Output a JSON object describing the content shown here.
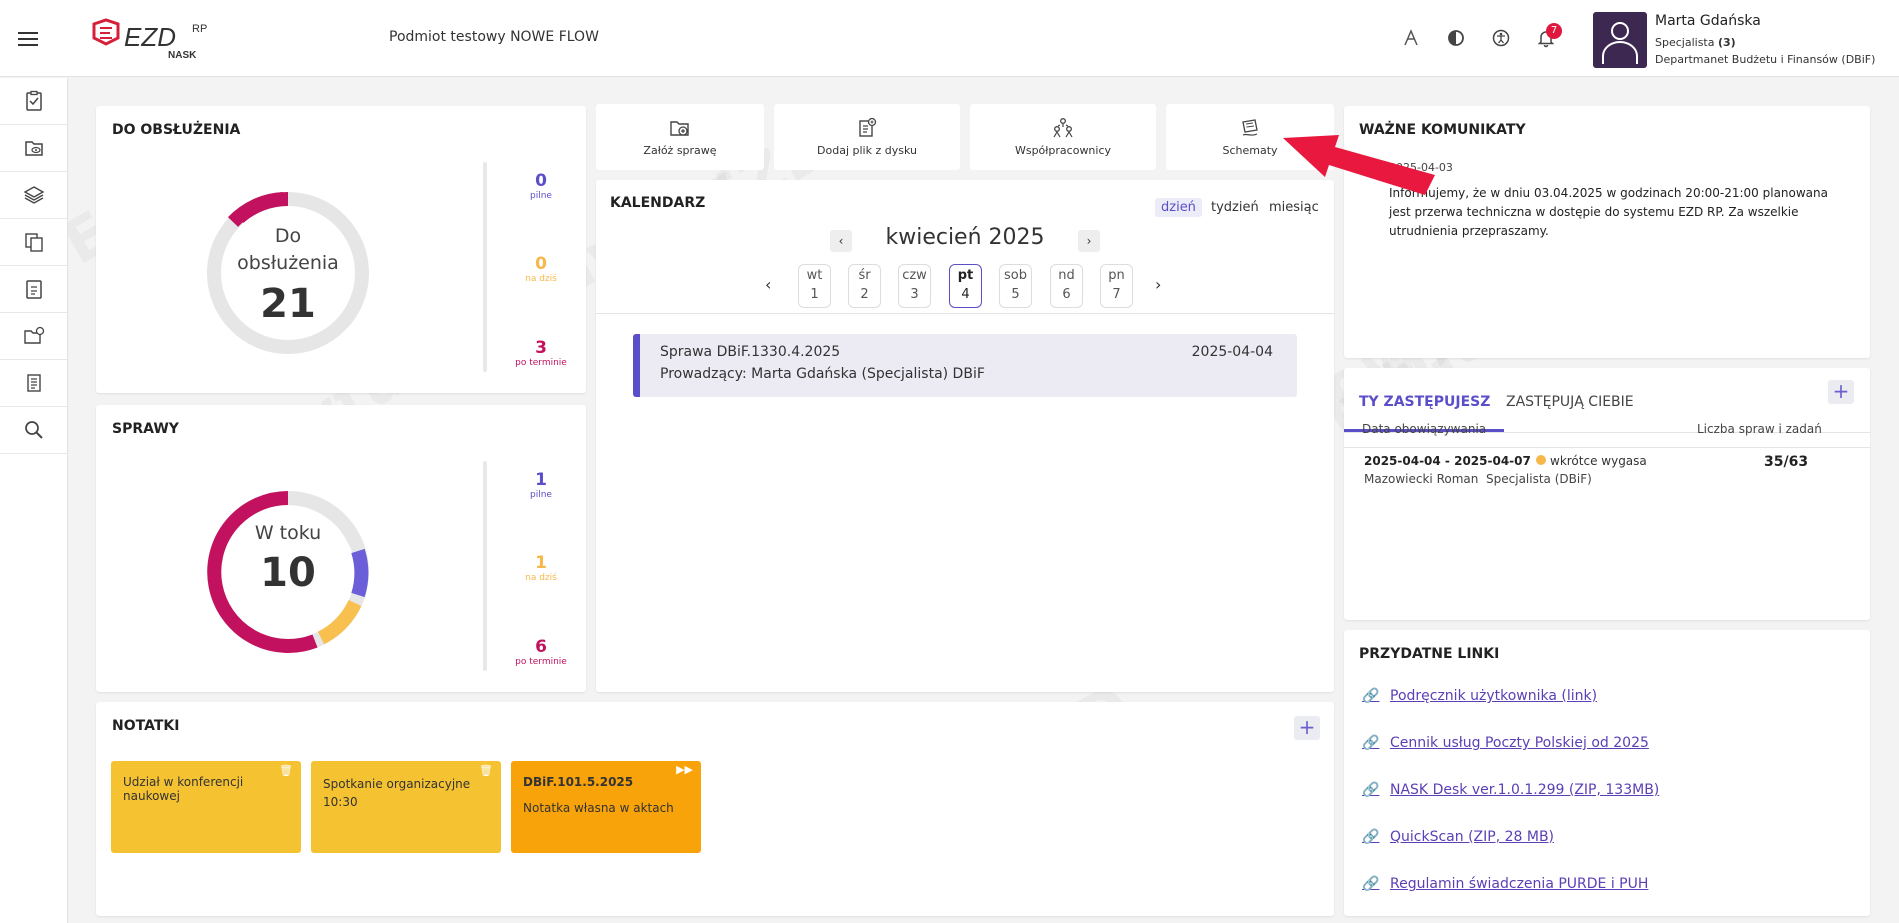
{
  "header": {
    "logo_text": "EZD",
    "logo_sup": "RP",
    "logo_sub": "NASK",
    "entity": "Podmiot testowy NOWE FLOW",
    "notifications_count": "7",
    "user": {
      "name": "Marta Gdańska",
      "role": "Specjalista",
      "role_count": "(3)",
      "department": "Departmanet Budżetu i Finansów (DBiF)"
    }
  },
  "sidebar": {
    "icons": [
      "clipboard-check-icon",
      "eye-folder-icon",
      "layers-icon",
      "documents-icon",
      "clipboard-list-icon",
      "folder-share-icon",
      "document-icon",
      "search-icon"
    ]
  },
  "do_obsluzenia": {
    "title": "DO OBSŁUŻENIA",
    "donut_label_1": "Do",
    "donut_label_2": "obsłużenia",
    "total": "21",
    "stats": [
      {
        "value": "0",
        "label": "pilne",
        "color": "#5b4fc9"
      },
      {
        "value": "0",
        "label": "na dziś",
        "color": "#f7b84a"
      },
      {
        "value": "3",
        "label": "po terminie",
        "color": "#c2125f"
      }
    ]
  },
  "sprawy": {
    "title": "SPRAWY",
    "donut_label": "W toku",
    "total": "10",
    "stats": [
      {
        "value": "1",
        "label": "pilne",
        "color": "#5b4fc9"
      },
      {
        "value": "1",
        "label": "na dziś",
        "color": "#f7b84a"
      },
      {
        "value": "6",
        "label": "po terminie",
        "color": "#c2125f"
      }
    ]
  },
  "quick_actions": [
    {
      "label": "Załóż sprawę",
      "icon": "folder-plus-icon"
    },
    {
      "label": "Dodaj plik z dysku",
      "icon": "file-upload-icon"
    },
    {
      "label": "Współpracownicy",
      "icon": "people-icon"
    },
    {
      "label": "Schematy",
      "icon": "schema-icon"
    }
  ],
  "calendar": {
    "title": "KALENDARZ",
    "views": [
      "dzień",
      "tydzień",
      "miesiąc"
    ],
    "month": "kwiecień 2025",
    "days": [
      {
        "dow": "wt",
        "num": "1"
      },
      {
        "dow": "śr",
        "num": "2"
      },
      {
        "dow": "czw",
        "num": "3"
      },
      {
        "dow": "pt",
        "num": "4"
      },
      {
        "dow": "sob",
        "num": "5"
      },
      {
        "dow": "nd",
        "num": "6"
      },
      {
        "dow": "pn",
        "num": "7"
      }
    ],
    "event": {
      "title": "Sprawa DBiF.1330.4.2025",
      "date": "2025-04-04",
      "owner": "Prowadzący: Marta Gdańska (Specjalista) DBiF"
    }
  },
  "komunikaty": {
    "title": "WAŻNE KOMUNIKATY",
    "date": "2025-04-03",
    "text": "Informujemy, że w dniu 03.04.2025 w godzinach 20:00-21:00 planowana jest przerwa techniczna w dostępie do systemu EZD RP. Za wszelkie utrudnienia przepraszamy."
  },
  "zastepstwa": {
    "tabs": [
      "TY ZASTĘPUJESZ",
      "ZASTĘPUJĄ CIEBIE"
    ],
    "col_date": "Data obowiązywania",
    "col_count": "Liczba spraw i zadań",
    "row": {
      "range": "2025-04-04 - 2025-04-07",
      "status": "wkrótce wygasa",
      "count": "35/63",
      "person": "Mazowiecki Roman",
      "role": "Specjalista (DBiF)"
    }
  },
  "linki": {
    "title": "PRZYDATNE LINKI",
    "items": [
      "Podręcznik użytkownika (link)",
      "Cennik usług Poczty Polskiej od 2025",
      "NASK Desk ver.1.0.1.299 (ZIP, 133MB)",
      "QuickScan (ZIP, 28 MB)",
      "Regulamin świadczenia PURDE i PUH"
    ]
  },
  "notatki": {
    "title": "NOTATKI",
    "items": [
      {
        "text": "Udział w konferencji naukowej",
        "color": "#f5c232"
      },
      {
        "text": "Spotkanie organizacyjne 10:30",
        "color": "#f5c232"
      },
      {
        "heading": "DBiF.101.5.2025",
        "text": "Notatka własna w aktach",
        "color": "#f9a30b"
      }
    ]
  }
}
